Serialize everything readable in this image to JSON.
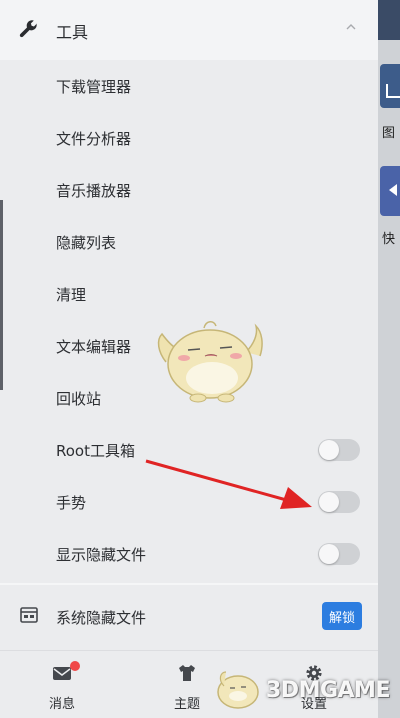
{
  "drawer": {
    "tools_section": {
      "title": "工具",
      "expanded": true,
      "icon": "wrench-icon"
    },
    "tools": [
      {
        "label": "下载管理器"
      },
      {
        "label": "文件分析器"
      },
      {
        "label": "音乐播放器"
      },
      {
        "label": "隐藏列表"
      },
      {
        "label": "清理"
      },
      {
        "label": "文本编辑器"
      },
      {
        "label": "回收站"
      },
      {
        "label": "Root工具箱",
        "toggle": false
      },
      {
        "label": "手势",
        "toggle": false
      },
      {
        "label": "显示隐藏文件",
        "toggle": false
      }
    ],
    "system_hidden": {
      "label": "系统隐藏文件",
      "icon": "hidden-file-icon",
      "button": "解锁"
    }
  },
  "bottom_nav": [
    {
      "label": "消息",
      "icon": "message-icon",
      "has_badge": true
    },
    {
      "label": "主题",
      "icon": "shirt-icon"
    },
    {
      "label": "设置",
      "icon": "gear-icon"
    }
  ],
  "background_app": {
    "label_1": "图",
    "label_2": "快"
  },
  "watermark": {
    "text": "3DMGAME"
  },
  "colors": {
    "accent": "#2c7de0",
    "arrow": "#e02424",
    "badge": "#f04848",
    "drawer_bg": "#ebecee"
  }
}
